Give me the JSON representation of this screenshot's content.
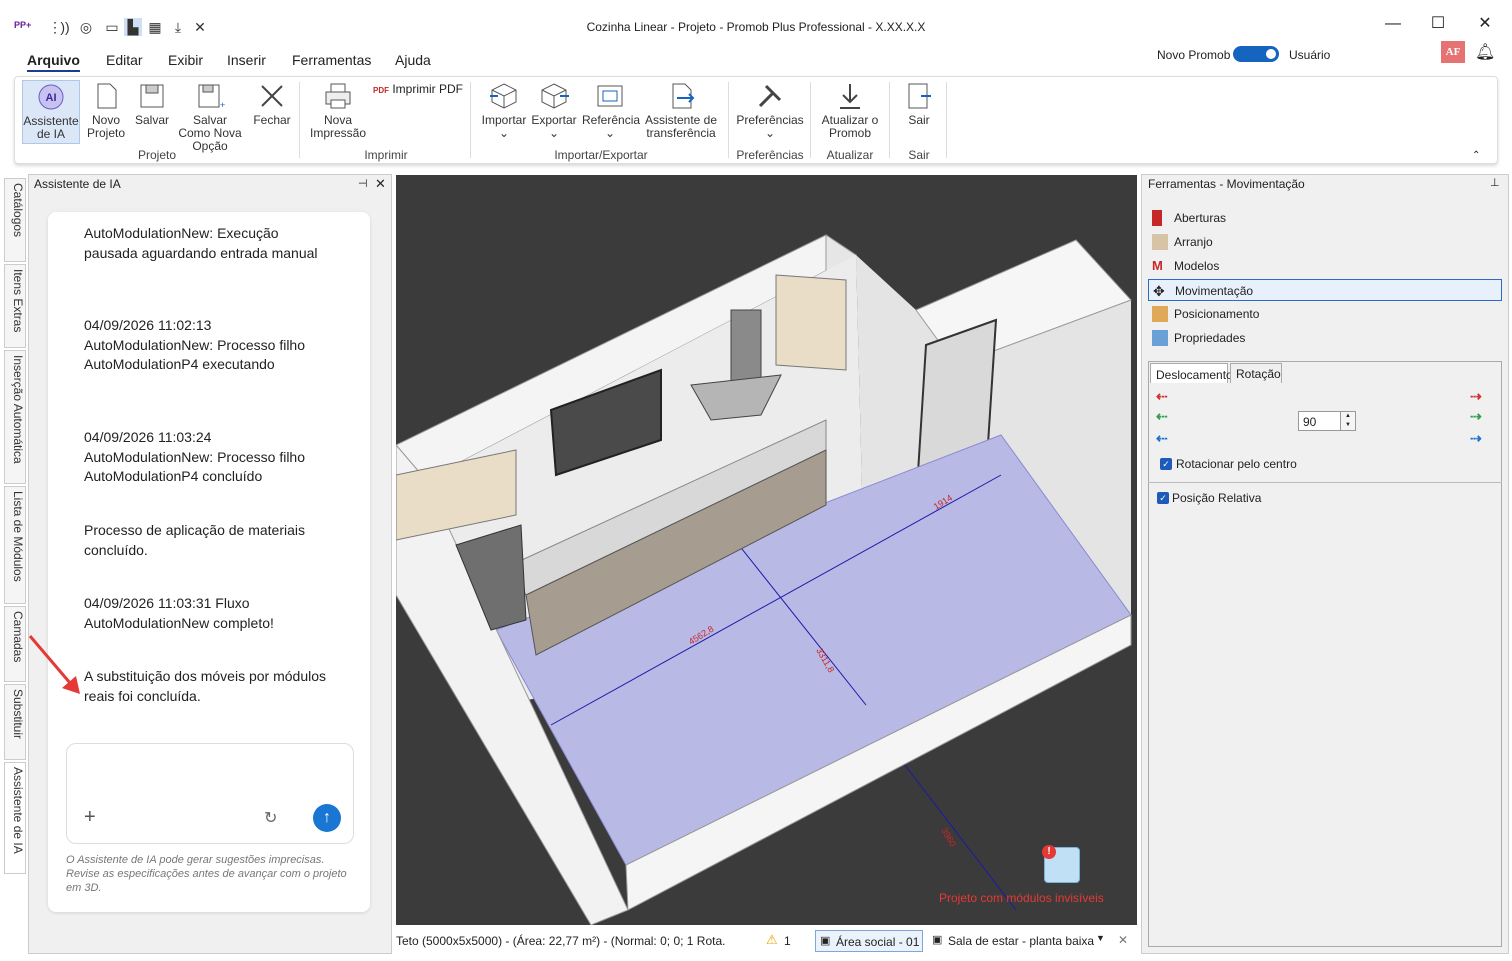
{
  "window": {
    "title": "Cozinha Linear - Projeto - Promob Plus Professional - X.XX.X.X",
    "minimize": "—",
    "maximize": "☐",
    "close": "✕"
  },
  "menu": [
    "Arquivo",
    "Editar",
    "Exibir",
    "Inserir",
    "Ferramentas",
    "Ajuda"
  ],
  "header": {
    "novo_promob": "Novo Promob",
    "usuario": "Usuário",
    "avatar": "AF"
  },
  "ribbon": {
    "buttons": {
      "ai": "Assistente de IA",
      "novo": "Novo Projeto",
      "salvar": "Salvar",
      "salvar_como": "Salvar Como Nova Opção",
      "fechar": "Fechar",
      "nova_impressao": "Nova Impressão",
      "imprimir_pdf": "Imprimir PDF",
      "importar": "Importar",
      "exportar": "Exportar",
      "referencia": "Referência",
      "assistente_transf": "Assistente de transferência",
      "preferencias": "Preferências",
      "atualizar": "Atualizar o Promob",
      "sair": "Sair"
    },
    "groups": {
      "projeto": "Projeto",
      "imprimir": "Imprimir",
      "import_export": "Importar/Exportar",
      "preferencias": "Preferências",
      "atualizar": "Atualizar",
      "sair": "Sair"
    }
  },
  "left_tabs": [
    "Catálogos",
    "Itens Extras",
    "Inserção Automática",
    "Lista de Módulos",
    "Camadas",
    "Substituir",
    "Assistente de IA"
  ],
  "left_panel": {
    "title": "Assistente de IA",
    "messages": [
      "AutoModulationNew: Execução pausada aguardando entrada manual",
      "04/09/2026 11:02:13 AutoModulationNew: Processo filho AutoModulationP4 executando",
      "04/09/2026 11:03:24 AutoModulationNew: Processo filho AutoModulationP4 concluído",
      "Processo de aplicação de materiais concluído.",
      "04/09/2026 11:03:31 Fluxo AutoModulationNew completo!",
      "A substituição dos móveis por módulos reais foi concluída."
    ],
    "input_placeholder": "",
    "disclaimer": "O Assistente de IA pode gerar sugestões imprecisas. Revise as especificações antes de avançar com o projeto em 3D."
  },
  "viewport": {
    "dims": [
      "4562,8",
      "3311,8",
      "1914",
      "3960"
    ],
    "warning_text": "Projeto com módulos invisíveis"
  },
  "statusbar": {
    "info": "Teto (5000x5x5000) - (Área: 22,77 m²) - (Normal: 0; 0; 1 Rota...",
    "warnings": "1",
    "area_tab": "Área social - 01",
    "room_tab": "Sala de estar - planta baixa"
  },
  "right_panel": {
    "title": "Ferramentas - Movimentação",
    "tools": [
      "Aberturas",
      "Arranjo",
      "Modelos",
      "Movimentação",
      "Posicionamento",
      "Propriedades"
    ],
    "tabs": [
      "Deslocamento",
      "Rotação"
    ],
    "rotation_value": "90",
    "rotate_center": "Rotacionar pelo centro",
    "relative_pos": "Posição Relativa"
  },
  "colors": {
    "accent": "#1565c0",
    "floor": "#b9b9e6",
    "warning": "#e53935"
  }
}
